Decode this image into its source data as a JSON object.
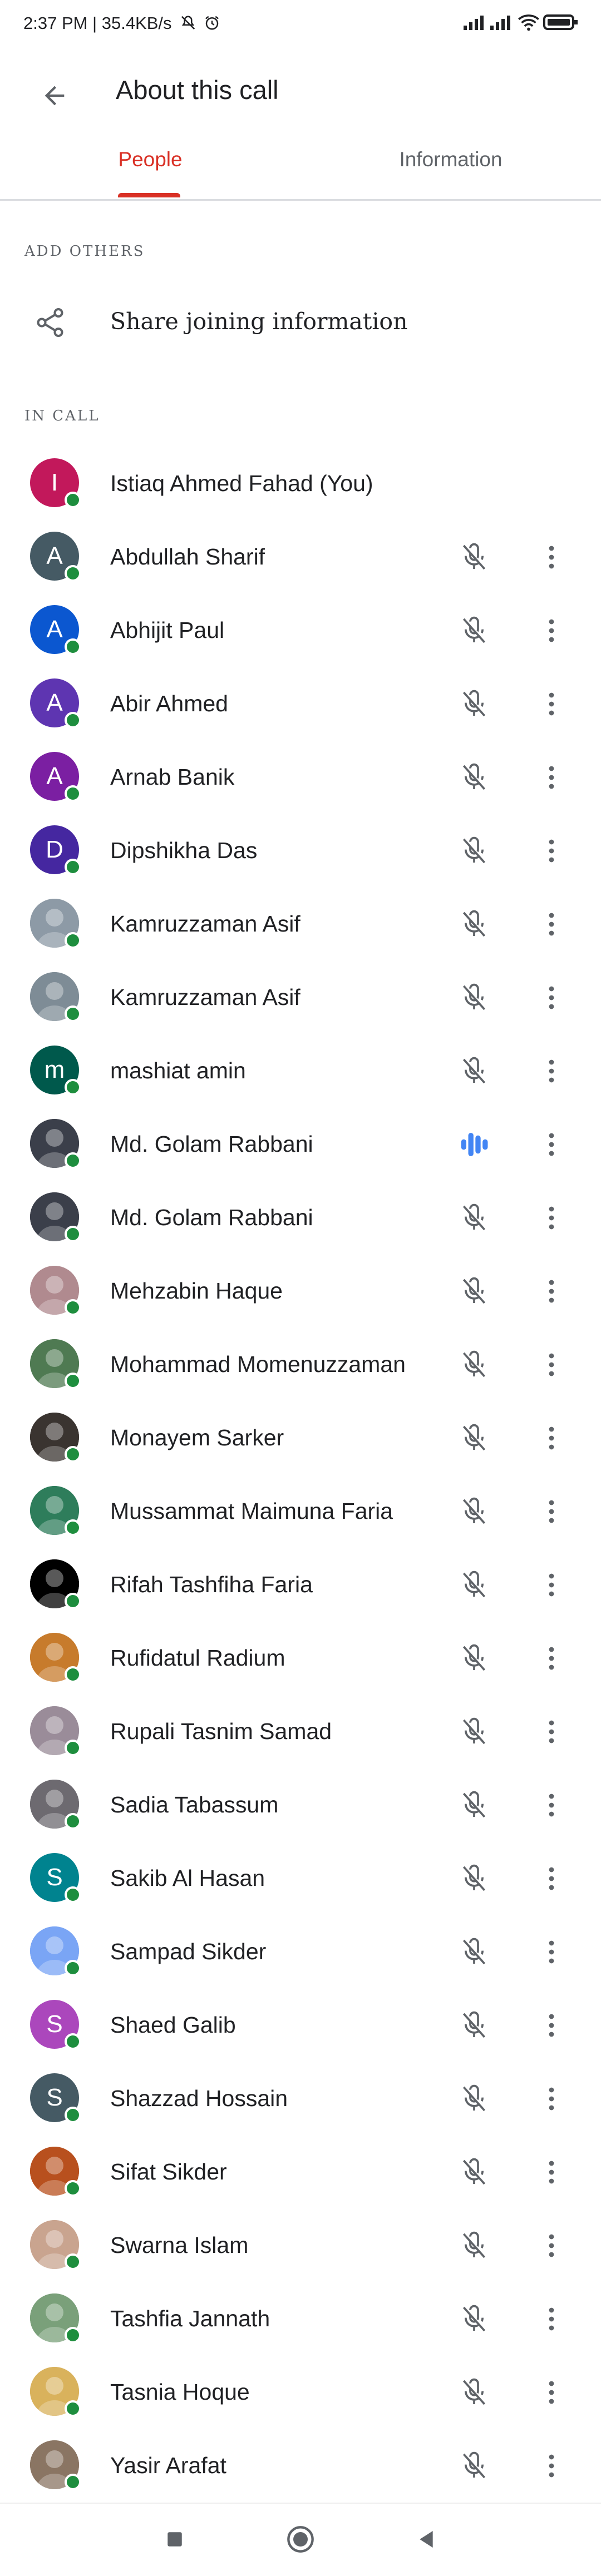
{
  "status_bar": {
    "text": "2:37 PM | 35.4KB/s",
    "icons": [
      "mute-icon",
      "alarm-icon",
      "signal-icon",
      "signal-icon",
      "wifi-icon",
      "battery-icon"
    ]
  },
  "app_bar": {
    "title": "About this call",
    "back_icon": "arrow-back-icon"
  },
  "tabs": [
    {
      "label": "People",
      "selected": true
    },
    {
      "label": "Information",
      "selected": false
    }
  ],
  "add_others": {
    "heading": "ADD OTHERS",
    "share_label": "Share joining information",
    "share_icon": "share-icon"
  },
  "in_call": {
    "heading": "IN CALL",
    "people": [
      {
        "name": "Istiaq Ahmed Fahad (You)",
        "initial": "I",
        "avatar_color": "#c2185b",
        "photo": false,
        "self": true
      },
      {
        "name": "Abdullah Sharif",
        "initial": "A",
        "avatar_color": "#455a64",
        "photo": false,
        "mic": "muted"
      },
      {
        "name": "Abhijit Paul",
        "initial": "A",
        "avatar_color": "#0b57d0",
        "photo": false,
        "mic": "muted"
      },
      {
        "name": "Abir Ahmed",
        "initial": "A",
        "avatar_color": "#5e35b1",
        "photo": false,
        "mic": "muted"
      },
      {
        "name": "Arnab Banik",
        "initial": "A",
        "avatar_color": "#7b1fa2",
        "photo": false,
        "mic": "muted"
      },
      {
        "name": "Dipshikha Das",
        "initial": "D",
        "avatar_color": "#4527a0",
        "photo": false,
        "mic": "muted"
      },
      {
        "name": "Kamruzzaman Asif",
        "initial": "",
        "avatar_color": "#8d9aa6",
        "photo": true,
        "mic": "muted"
      },
      {
        "name": "Kamruzzaman Asif",
        "initial": "",
        "avatar_color": "#7e8c96",
        "photo": true,
        "mic": "muted"
      },
      {
        "name": "mashiat amin",
        "initial": "m",
        "avatar_color": "#00594c",
        "photo": false,
        "mic": "muted"
      },
      {
        "name": "Md. Golam Rabbani",
        "initial": "",
        "avatar_color": "#3b3f4a",
        "photo": true,
        "mic": "speaking"
      },
      {
        "name": "Md. Golam Rabbani",
        "initial": "",
        "avatar_color": "#3b3f4a",
        "photo": true,
        "mic": "muted"
      },
      {
        "name": "Mehzabin Haque",
        "initial": "",
        "avatar_color": "#b08a8f",
        "photo": true,
        "mic": "muted"
      },
      {
        "name": "Mohammad Momenuzzaman",
        "initial": "",
        "avatar_color": "#4f7a52",
        "photo": true,
        "mic": "muted"
      },
      {
        "name": "Monayem Sarker",
        "initial": "",
        "avatar_color": "#3a3430",
        "photo": true,
        "mic": "muted"
      },
      {
        "name": "Mussammat Maimuna Faria",
        "initial": "",
        "avatar_color": "#2e7d5b",
        "photo": true,
        "mic": "muted"
      },
      {
        "name": "Rifah Tashfiha Faria",
        "initial": "",
        "avatar_color": "#000000",
        "photo": true,
        "mic": "muted"
      },
      {
        "name": "Rufidatul Radium",
        "initial": "",
        "avatar_color": "#c77b2c",
        "photo": true,
        "mic": "muted"
      },
      {
        "name": "Rupali Tasnim Samad",
        "initial": "",
        "avatar_color": "#9a8c99",
        "photo": true,
        "mic": "muted"
      },
      {
        "name": "Sadia Tabassum",
        "initial": "",
        "avatar_color": "#6d6a70",
        "photo": true,
        "mic": "muted"
      },
      {
        "name": "Sakib Al Hasan",
        "initial": "S",
        "avatar_color": "#00838f",
        "photo": false,
        "mic": "muted"
      },
      {
        "name": "Sampad Sikder",
        "initial": "",
        "avatar_color": "#7aa5f5",
        "photo": true,
        "mic": "muted"
      },
      {
        "name": "Shaed Galib",
        "initial": "S",
        "avatar_color": "#ab47bc",
        "photo": false,
        "mic": "muted"
      },
      {
        "name": "Shazzad Hossain",
        "initial": "S",
        "avatar_color": "#455a64",
        "photo": false,
        "mic": "muted"
      },
      {
        "name": "Sifat Sikder",
        "initial": "",
        "avatar_color": "#b8501e",
        "photo": true,
        "mic": "muted"
      },
      {
        "name": "Swarna Islam",
        "initial": "",
        "avatar_color": "#c9a48f",
        "photo": true,
        "mic": "muted"
      },
      {
        "name": "Tashfia Jannath",
        "initial": "",
        "avatar_color": "#7aa07a",
        "photo": true,
        "mic": "muted"
      },
      {
        "name": "Tasnia Hoque",
        "initial": "",
        "avatar_color": "#d9b25c",
        "photo": true,
        "mic": "muted"
      },
      {
        "name": "Yasir Arafat",
        "initial": "",
        "avatar_color": "#8a7563",
        "photo": true,
        "mic": "muted"
      }
    ]
  },
  "nav_bar": {
    "buttons": [
      "recents-icon",
      "home-icon",
      "back-icon"
    ]
  },
  "colors": {
    "accent": "#d93025",
    "online": "#1e8e3e",
    "speaking": "#4285f4",
    "text": "#202124",
    "muted_text": "#5f6368"
  }
}
